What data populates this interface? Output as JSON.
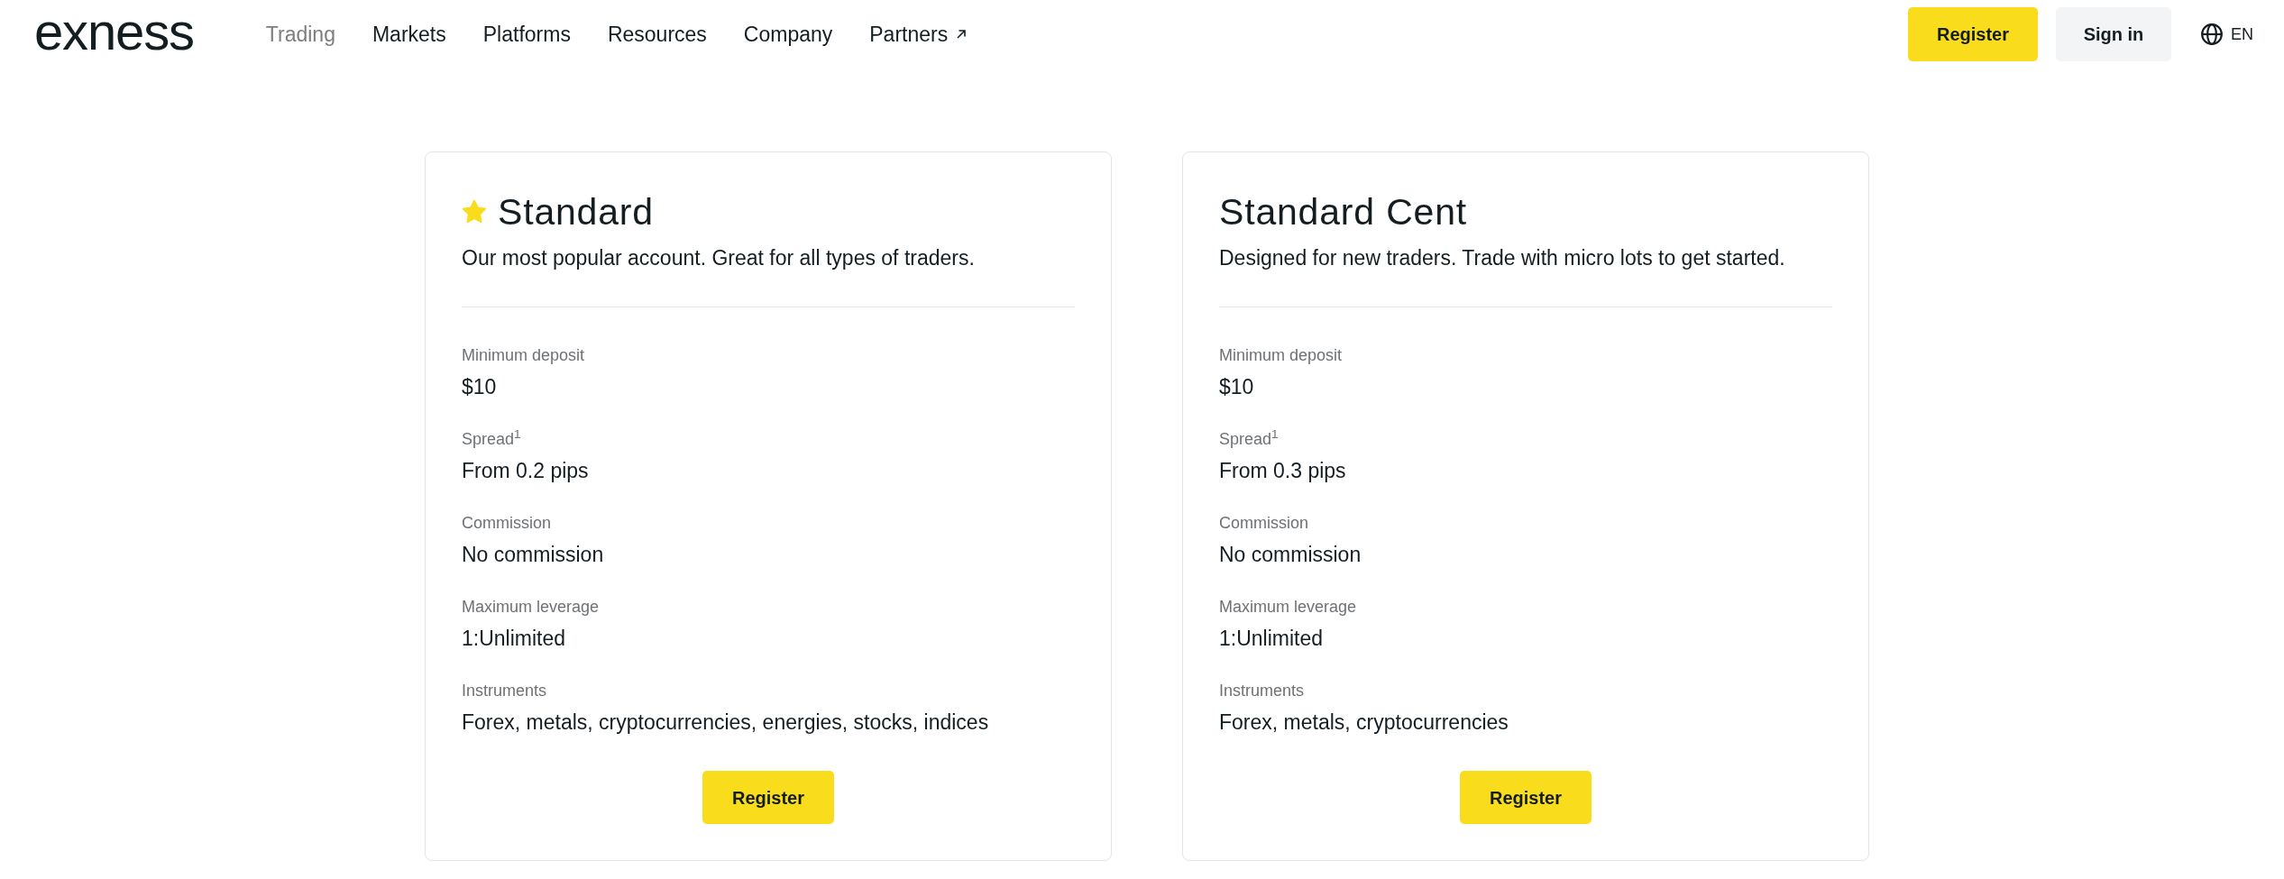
{
  "header": {
    "logo": "exness",
    "nav": [
      {
        "label": "Trading",
        "selected": true,
        "external": false
      },
      {
        "label": "Markets",
        "selected": false,
        "external": false
      },
      {
        "label": "Platforms",
        "selected": false,
        "external": false
      },
      {
        "label": "Resources",
        "selected": false,
        "external": false
      },
      {
        "label": "Company",
        "selected": false,
        "external": false
      },
      {
        "label": "Partners",
        "selected": false,
        "external": true
      }
    ],
    "buttons": [
      {
        "label": "Register",
        "kind": "primary"
      },
      {
        "label": "Sign in",
        "kind": "secondary"
      }
    ],
    "language": "EN"
  },
  "accounts": [
    {
      "name": "Standard",
      "featured": true,
      "description": "Our most popular account. Great for all types of traders.",
      "specs": [
        {
          "label": "Minimum deposit",
          "value": "$10"
        },
        {
          "label": "Spread$^{1}$",
          "value": "From 0.2 pips"
        },
        {
          "label": "Commission",
          "value": "No commission"
        },
        {
          "label": "Maximum leverage",
          "value": "1:Unlimited"
        },
        {
          "label": "Instruments",
          "value": "Forex, metals, cryptocurrencies, energies, stocks, indices"
        }
      ],
      "button": "Register"
    },
    {
      "name": "Standard Cent",
      "featured": false,
      "description": "Designed for new traders. Trade with micro lots to get started.",
      "specs": [
        {
          "label": "Minimum deposit",
          "value": "$10"
        },
        {
          "label": "Spread$^{1}$",
          "value": "From 0.3 pips"
        },
        {
          "label": "Commission",
          "value": "No commission"
        },
        {
          "label": "Maximum leverage",
          "value": "1:Unlimited"
        },
        {
          "label": "Instruments",
          "value": "Forex, metals, cryptocurrencies"
        }
      ],
      "button": "Register"
    }
  ]
}
